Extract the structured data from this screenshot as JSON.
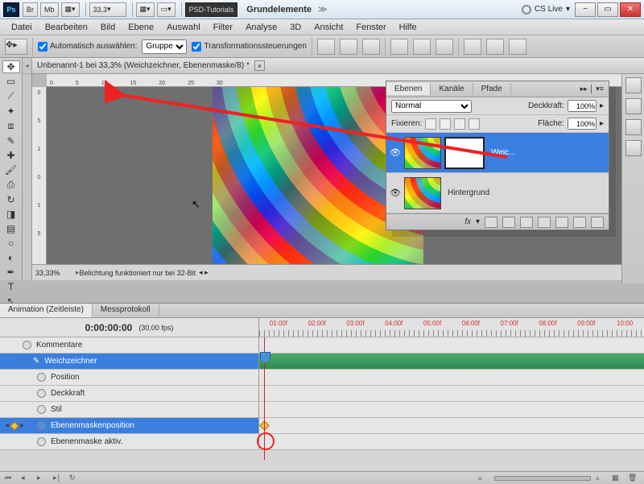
{
  "titlebar": {
    "ps": "Ps",
    "br": "Br",
    "mb": "Mb",
    "zoom": "33,3",
    "psd_tutorials": "PSD-Tutorials",
    "grundelemente": "Grundelemente",
    "cslive": "CS Live"
  },
  "menu": [
    "Datei",
    "Bearbeiten",
    "Bild",
    "Ebene",
    "Auswahl",
    "Filter",
    "Analyse",
    "3D",
    "Ansicht",
    "Fenster",
    "Hilfe"
  ],
  "optbar": {
    "auto_select": "Automatisch auswählen:",
    "group": "Gruppe",
    "transform": "Transformationssteuerungen"
  },
  "doc": {
    "tab": "Unbenannt-1 bei 33,3% (Weichzeichner, Ebenenmaske/8) *",
    "zoom": "33,33%",
    "status": "Belichtung funktioniert nur bei 32-Bit",
    "ruler_h": [
      "0",
      "5",
      "10",
      "15",
      "20",
      "25",
      "30"
    ],
    "ruler_v": [
      "0",
      "5",
      "1",
      "0",
      "1",
      "5"
    ]
  },
  "layers_panel": {
    "tabs": [
      "Ebenen",
      "Kanäle",
      "Pfade"
    ],
    "blendmode": "Normal",
    "opacity_label": "Deckkraft:",
    "opacity": "100%",
    "fix_label": "Fixieren:",
    "fill_label": "Fläche:",
    "fill": "100%",
    "layers": [
      {
        "name": "Weic...",
        "selected": true,
        "has_mask": true
      },
      {
        "name": "Hintergrund",
        "selected": false,
        "has_mask": false
      }
    ]
  },
  "timeline": {
    "tabs": [
      "Animation (Zeitleiste)",
      "Messprotokoll"
    ],
    "time": "0:00:00:00",
    "fps": "(30,00 fps)",
    "marks": [
      "01:00f",
      "02:00f",
      "03:00f",
      "04:00f",
      "05:00f",
      "06:00f",
      "07:00f",
      "08:00f",
      "09:00f",
      "10:00"
    ],
    "tracks": {
      "kommentare": "Kommentare",
      "weichzeichner": "Weichzeichner",
      "position": "Position",
      "deckkraft": "Deckkraft",
      "stil": "Stil",
      "ebenenmaskenposition": "Ebenenmaskenposition",
      "ebenenmaske_aktiv": "Ebenenmaske aktiv."
    }
  }
}
